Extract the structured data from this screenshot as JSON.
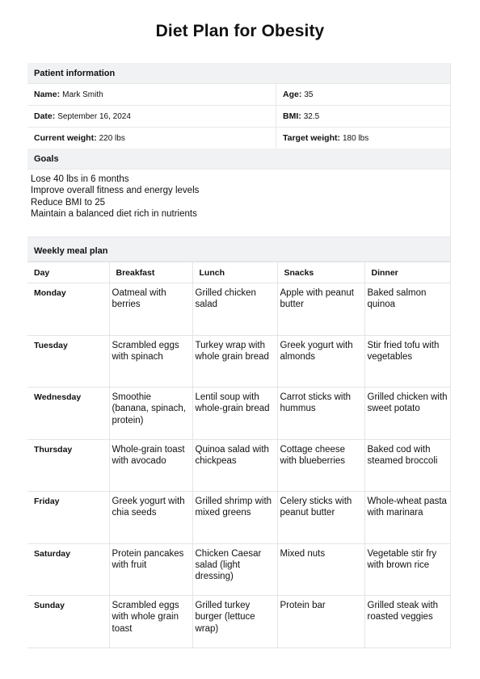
{
  "title": "Diet Plan for Obesity",
  "patient_information": {
    "header": "Patient information",
    "fields": [
      {
        "label": "Name:",
        "value": "Mark Smith"
      },
      {
        "label": "Age:",
        "value": "35"
      },
      {
        "label": "Date:",
        "value": "September 16, 2024"
      },
      {
        "label": "BMI:",
        "value": "32.5"
      },
      {
        "label": "Current weight:",
        "value": "220 lbs"
      },
      {
        "label": "Target weight:",
        "value": "180 lbs"
      }
    ]
  },
  "goals": {
    "header": "Goals",
    "items": [
      "Lose 40 lbs in 6 months",
      "Improve overall fitness and energy levels",
      "Reduce BMI to 25",
      "Maintain a balanced diet rich in nutrients"
    ]
  },
  "meal_plan": {
    "header": "Weekly meal plan",
    "columns": [
      "Day",
      "Breakfast",
      "Lunch",
      "Snacks",
      "Dinner"
    ],
    "rows": [
      [
        "Monday",
        "Oatmeal with berries",
        "Grilled chicken salad",
        "Apple with peanut butter",
        "Baked salmon quinoa"
      ],
      [
        "Tuesday",
        "Scrambled eggs with spinach",
        "Turkey wrap with whole grain bread",
        "Greek yogurt with almonds",
        "Stir fried tofu with vegetables"
      ],
      [
        "Wednesday",
        "Smoothie (banana, spinach, protein)",
        "Lentil soup with whole-grain bread",
        "Carrot sticks with hummus",
        "Grilled chicken with sweet potato"
      ],
      [
        "Thursday",
        "Whole-grain toast with avocado",
        "Quinoa salad with chickpeas",
        "Cottage cheese with blueberries",
        "Baked cod with steamed broccoli"
      ],
      [
        "Friday",
        "Greek yogurt with chia seeds",
        "Grilled shrimp with mixed greens",
        "Celery sticks with peanut butter",
        "Whole-wheat pasta with marinara"
      ],
      [
        "Saturday",
        "Protein pancakes with fruit",
        "Chicken Caesar salad (light dressing)",
        "Mixed nuts",
        "Vegetable stir fry with brown rice"
      ],
      [
        "Sunday",
        "Scrambled eggs with whole grain toast",
        "Grilled turkey burger (lettuce wrap)",
        "Protein bar",
        "Grilled steak with roasted veggies"
      ]
    ]
  }
}
